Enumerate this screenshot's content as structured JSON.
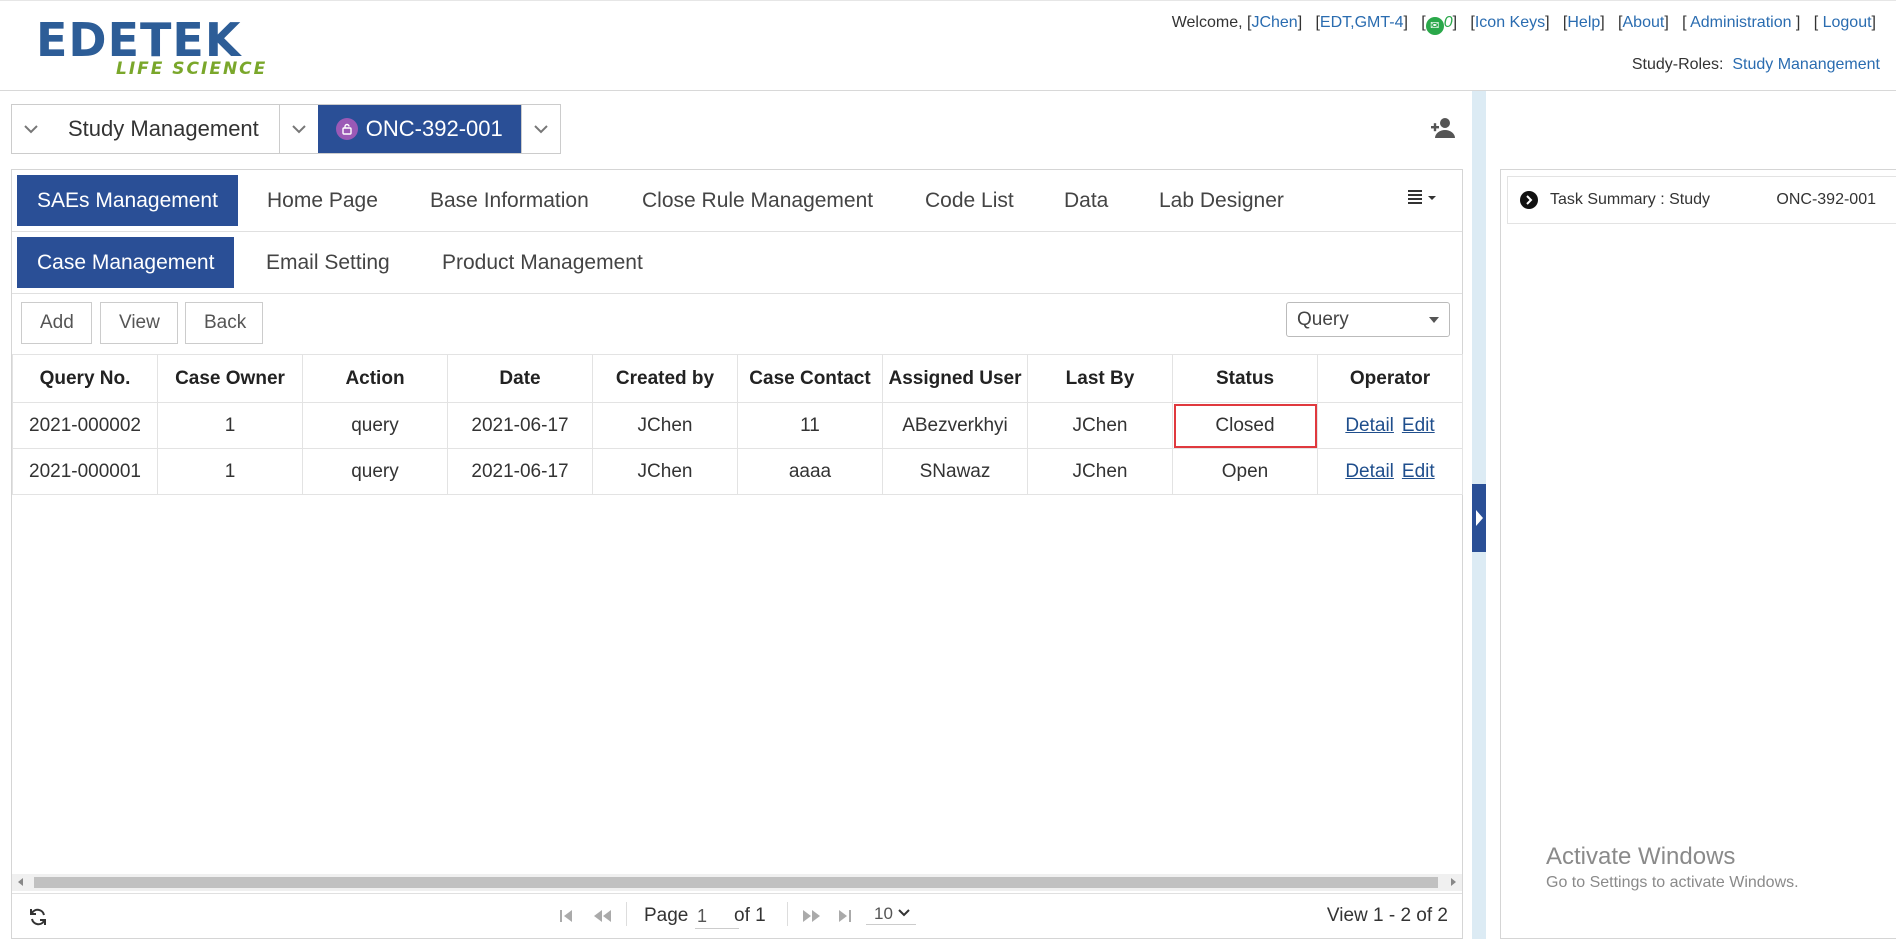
{
  "header": {
    "logo_main": "EDETEK",
    "logo_sub": "LIFE SCIENCE",
    "welcome_prefix": "Welcome, [",
    "user": "JChen",
    "timezone": "EDT,GMT-4",
    "mail_count": "0",
    "links": {
      "icon_keys": "Icon Keys",
      "help": "Help",
      "about": "About",
      "administration": "Administration",
      "logout": "Logout"
    },
    "study_roles_label": "Study-Roles:",
    "study_roles_value": "Study Manangement"
  },
  "selector": {
    "study": "Study Management",
    "trial": "ONC-392-001"
  },
  "tabs_row1": [
    "SAEs Management",
    "Home Page",
    "Base Information",
    "Close Rule Management",
    "Code List",
    "Data",
    "Lab Designer"
  ],
  "tabs_row2": [
    "Case Management",
    "Email Setting",
    "Product Management"
  ],
  "toolbar": {
    "add": "Add",
    "view": "View",
    "back": "Back",
    "filter_selected": "Query"
  },
  "table": {
    "columns": [
      "Query No.",
      "Case Owner",
      "Action",
      "Date",
      "Created by",
      "Case Contact",
      "Assigned User",
      "Last By",
      "Status",
      "Operator"
    ],
    "rows": [
      [
        "2021-000002",
        "1",
        "query",
        "2021-06-17",
        "JChen",
        "11",
        "ABezverkhyi",
        "JChen",
        "Closed"
      ],
      [
        "2021-000001",
        "1",
        "query",
        "2021-06-17",
        "JChen",
        "aaaa",
        "SNawaz",
        "JChen",
        "Open"
      ]
    ],
    "detail_label": "Detail",
    "edit_label": "Edit"
  },
  "pager": {
    "page_label": "Page",
    "page_value": "1",
    "of_label": "of 1",
    "page_size": "10",
    "summary": "View 1 - 2 of 2"
  },
  "task_summary": {
    "label": "Task Summary : Study",
    "study": "ONC-392-001"
  },
  "watermark": {
    "title": "Activate Windows",
    "subtitle": "Go to Settings to activate Windows."
  },
  "colors": {
    "primary": "#2a4f96",
    "link": "#2a6cb0",
    "logo_blue": "#2d5d97",
    "logo_green": "#7aa72b",
    "status_highlight": "#e0393e"
  }
}
